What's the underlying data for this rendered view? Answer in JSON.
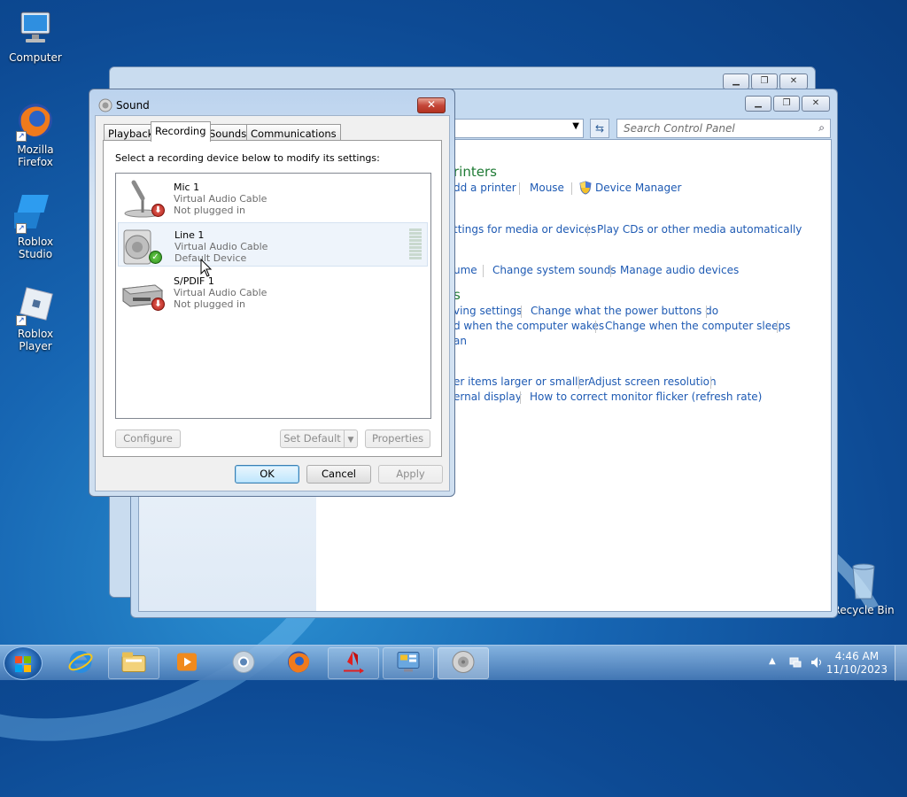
{
  "desktop": {
    "icons": [
      {
        "label": "Computer",
        "icon": "computer-icon"
      },
      {
        "label": "Mozilla Firefox",
        "icon": "firefox-icon"
      },
      {
        "label": "Roblox Studio",
        "icon": "roblox-studio-icon"
      },
      {
        "label": "Roblox Player",
        "icon": "roblox-player-icon"
      },
      {
        "label": "Recycle Bin",
        "icon": "recycle-bin-icon"
      }
    ]
  },
  "control_panel": {
    "search_placeholder": "Search Control Panel",
    "section_printers": "rinters",
    "links_row1": [
      "dd a printer",
      "Mouse",
      "Device Manager"
    ],
    "links_row2": [
      "ttings for media or devices",
      "Play CDs or other media automatically"
    ],
    "links_row3": [
      "ume",
      "Change system sounds",
      "Manage audio devices"
    ],
    "section_power": "s",
    "links_row4": [
      "ving settings",
      "Change what the power buttons do"
    ],
    "links_row5": [
      "d when the computer wakes",
      "Change when the computer sleeps"
    ],
    "links_row6": "an",
    "links_row7": [
      "er items larger or smaller",
      "Adjust screen resolution"
    ],
    "links_row8": [
      "ernal display",
      "How to correct monitor flicker (refresh rate)"
    ]
  },
  "sound_dialog": {
    "title": "Sound",
    "close": "✕",
    "tabs": [
      "Playback",
      "Recording",
      "Sounds",
      "Communications"
    ],
    "active_tab": "Recording",
    "instruction": "Select a recording device below to modify its settings:",
    "devices": [
      {
        "name": "Mic 1",
        "driver": "Virtual Audio Cable",
        "status": "Not plugged in"
      },
      {
        "name": "Line 1",
        "driver": "Virtual Audio Cable",
        "status": "Default Device"
      },
      {
        "name": "S/PDIF 1",
        "driver": "Virtual Audio Cable",
        "status": "Not plugged in"
      }
    ],
    "buttons": {
      "configure": "Configure",
      "set_default": "Set Default",
      "properties": "Properties",
      "ok": "OK",
      "cancel": "Cancel",
      "apply": "Apply"
    }
  },
  "taskbar": {
    "clock_time": "4:46 AM",
    "clock_date": "11/10/2023"
  }
}
